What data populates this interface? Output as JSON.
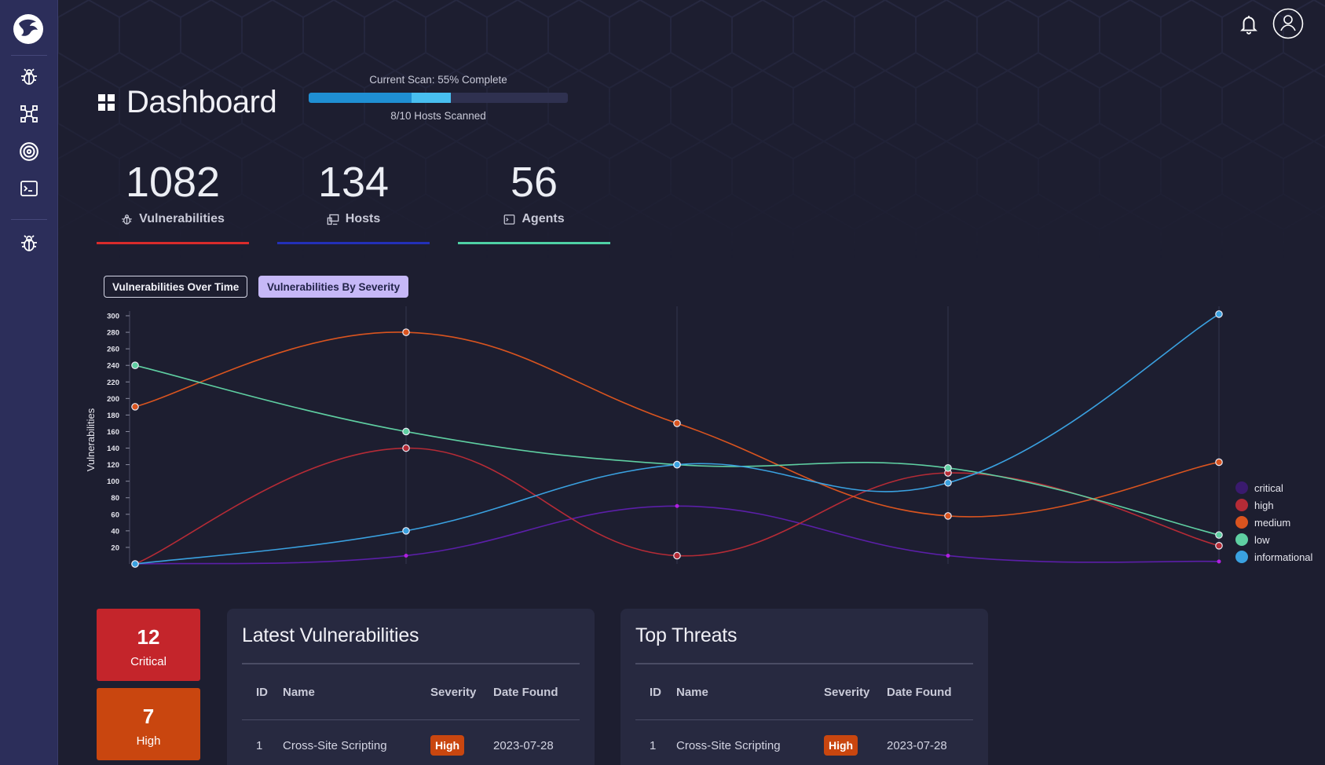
{
  "header": {
    "title": "Dashboard"
  },
  "scan": {
    "label": "Current Scan: 55% Complete",
    "progress": 0.55,
    "subtext": "8/10 Hosts Scanned"
  },
  "stats": [
    {
      "value": "1082",
      "label": "Vulnerabilities",
      "color": "#d92b2b"
    },
    {
      "value": "134",
      "label": "Hosts",
      "color": "#2330b8"
    },
    {
      "value": "56",
      "label": "Agents",
      "color": "#4fd1a5"
    }
  ],
  "tabs": [
    {
      "label": "Vulnerabilities Over Time"
    },
    {
      "label": "Vulnerabilities By Severity"
    }
  ],
  "chart_data": {
    "type": "line",
    "ylabel": "Vulnerabilities",
    "ylim": [
      0,
      300
    ],
    "yticks": [
      20,
      40,
      60,
      80,
      100,
      120,
      140,
      160,
      180,
      200,
      220,
      240,
      260,
      280,
      300
    ],
    "x": [
      0,
      1,
      2,
      3,
      4
    ],
    "grid": "vertical",
    "legend_position": "right",
    "series": [
      {
        "name": "critical",
        "color": "#5b1fa8",
        "values": [
          0,
          10,
          70,
          10,
          3
        ]
      },
      {
        "name": "high",
        "color": "#b52b36",
        "values": [
          0,
          140,
          10,
          110,
          22
        ]
      },
      {
        "name": "medium",
        "color": "#d9541f",
        "values": [
          190,
          280,
          170,
          58,
          123
        ]
      },
      {
        "name": "low",
        "color": "#5fcfa2",
        "values": [
          240,
          160,
          120,
          116,
          35
        ]
      },
      {
        "name": "informational",
        "color": "#3aa1e0",
        "values": [
          0,
          40,
          120,
          98,
          302
        ]
      }
    ]
  },
  "severity_cards": [
    {
      "count": "12",
      "label": "Critical",
      "color": "#c4252b"
    },
    {
      "count": "7",
      "label": "High",
      "color": "#c9460f"
    }
  ],
  "latest": {
    "title": "Latest Vulnerabilities",
    "columns": [
      "ID",
      "Name",
      "Severity",
      "Date Found"
    ],
    "rows": [
      {
        "id": "1",
        "name": "Cross-Site Scripting",
        "severity": "High",
        "date": "2023-07-28"
      }
    ]
  },
  "threats": {
    "title": "Top Threats",
    "columns": [
      "ID",
      "Name",
      "Severity",
      "Date Found"
    ],
    "rows": [
      {
        "id": "1",
        "name": "Cross-Site Scripting",
        "severity": "High",
        "date": "2023-07-28"
      }
    ]
  }
}
